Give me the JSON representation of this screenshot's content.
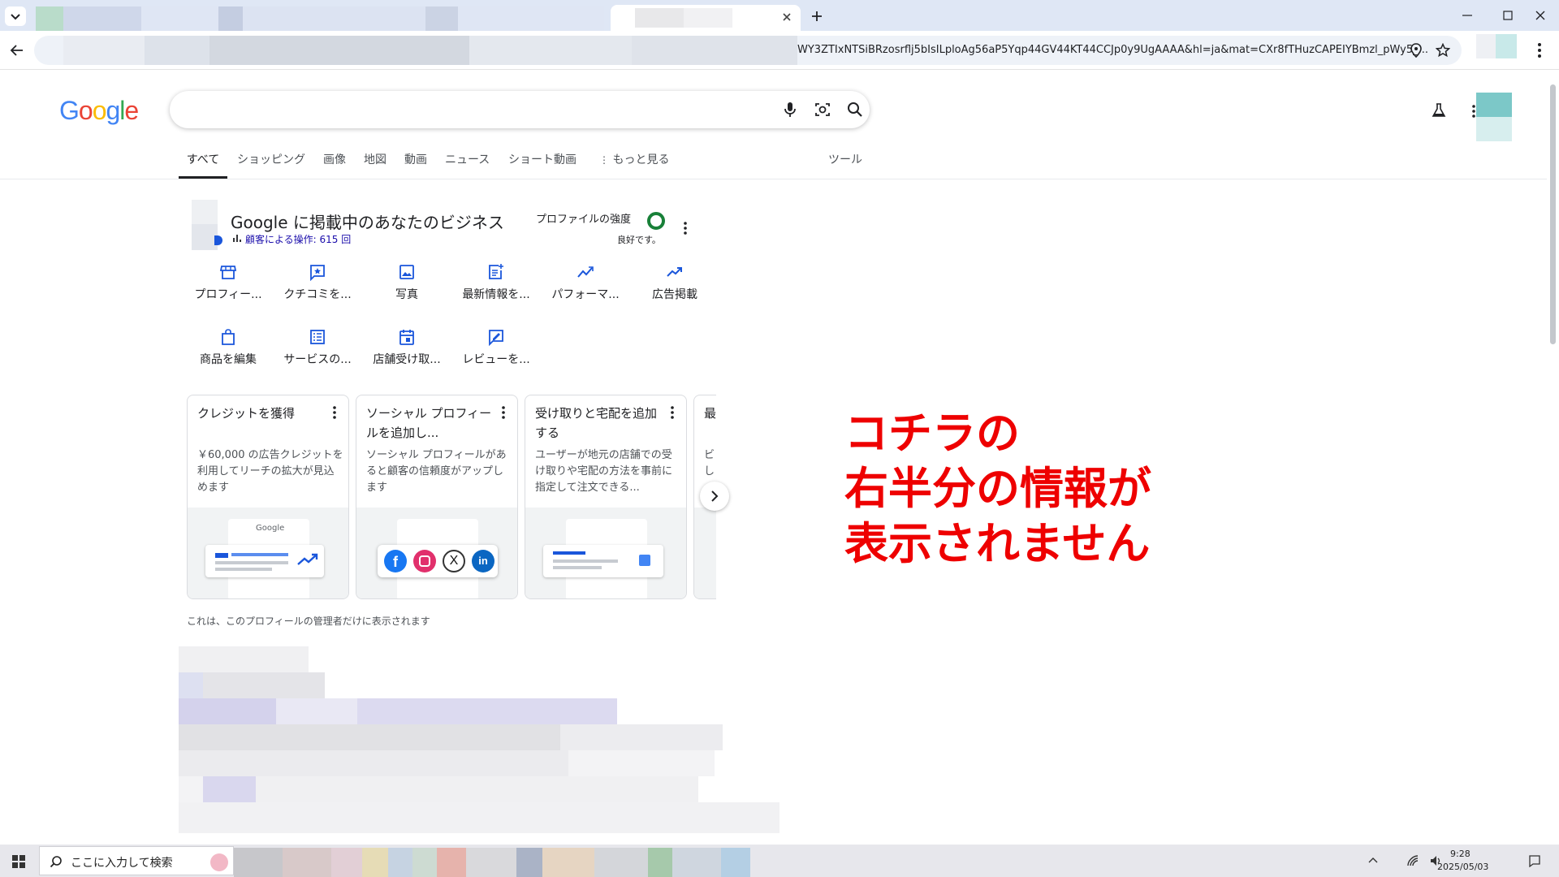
{
  "browser": {
    "url": "WY3ZTIxNTSiBRzosrflj5bIsILploAg56aP5Yqp44GV44KT44CCJp0y9UgAAAA&hl=ja&mat=CXr8fTHuzCAPEIYBmzl_pWy5_..."
  },
  "google": {
    "logo": "Google",
    "search_value": "",
    "tabs": [
      "すべて",
      "ショッピング",
      "画像",
      "地図",
      "動画",
      "ニュース",
      "ショート動画",
      "もっと見る",
      "ツール"
    ]
  },
  "business": {
    "title": "Google に掲載中のあなたのビジネス",
    "customer_ops": "顧客による操作: 615 回",
    "strength_label": "プロファイルの強度",
    "strength_status": "良好です。",
    "actions_row1": [
      "プロフィー...",
      "クチコミを...",
      "写真",
      "最新情報を...",
      "パフォーマ...",
      "広告掲載"
    ],
    "actions_row2": [
      "商品を編集",
      "サービスの...",
      "店舗受け取...",
      "レビューを..."
    ],
    "cards": [
      {
        "title": "クレジットを獲得",
        "desc": "￥60,000 の広告クレジットを利用してリーチの拡大が見込めます"
      },
      {
        "title": "ソーシャル プロフィールを追加し...",
        "desc": "ソーシャル プロフィールがあると顧客の信頼度がアップします"
      },
      {
        "title": "受け取りと宅配を追加する",
        "desc": "ユーザーが地元の店舗での受け取りや宅配の方法を事前に指定して注文できる..."
      },
      {
        "title": "最",
        "desc": "ビし"
      }
    ],
    "card_image_logo": "Google",
    "admin_note": "これは、このプロフィールの管理者だけに表示されます"
  },
  "annotation": {
    "line1": "コチラの",
    "line2": "右半分の情報が",
    "line3": "表示されません"
  },
  "taskbar": {
    "search_placeholder": "ここに入力して検索",
    "time": "9:28",
    "date": "2025/05/03"
  },
  "colors": {
    "annotation": "#ee0000",
    "accent_blue": "#1a56db",
    "link": "#1a0dab"
  }
}
